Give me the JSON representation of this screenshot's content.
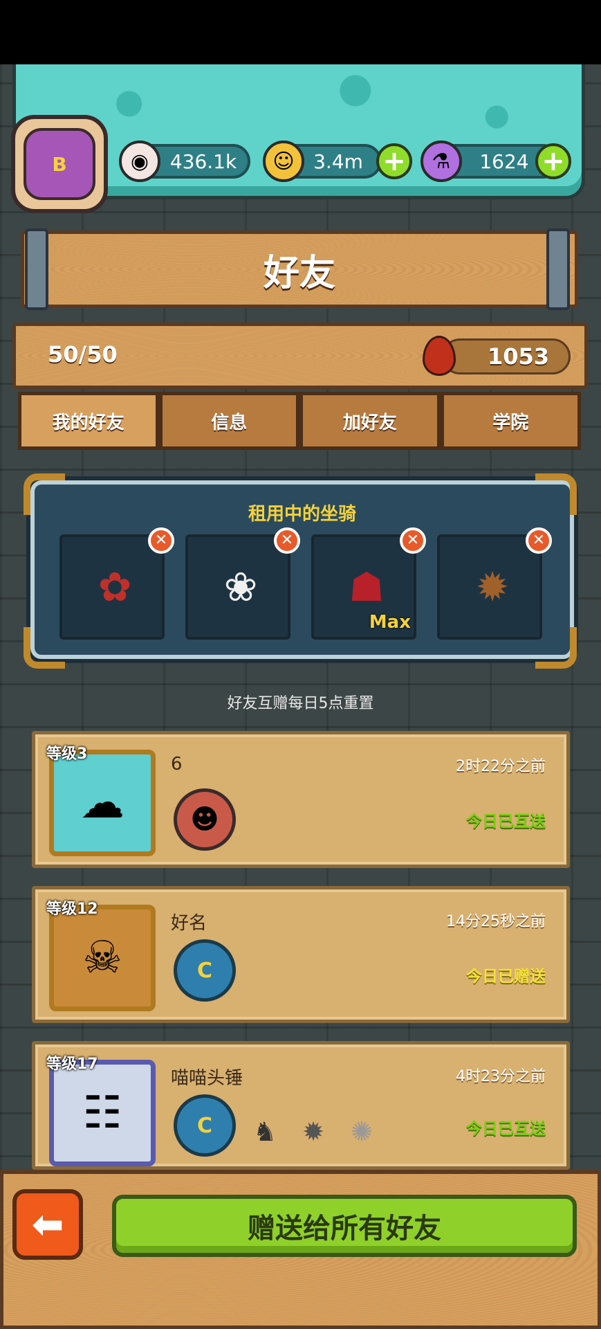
{
  "hud": {
    "avatar_grade": "B",
    "eyeball_value": "436.1k",
    "coin_value": "3.4m",
    "potion_value": "1624"
  },
  "header": {
    "title": "好友"
  },
  "stats": {
    "friend_count": "50/50",
    "blood_value": "1053"
  },
  "tabs": [
    {
      "label": "我的好友",
      "active": true
    },
    {
      "label": "信息",
      "active": false
    },
    {
      "label": "加好友",
      "active": false
    },
    {
      "label": "学院",
      "active": false
    }
  ],
  "rental": {
    "title": "租用中的坐骑",
    "mounts": [
      {
        "icon": "rose-mount-icon",
        "tag": ""
      },
      {
        "icon": "lion-dance-mount-icon",
        "tag": ""
      },
      {
        "icon": "red-demon-mount-icon",
        "tag": "Max"
      },
      {
        "icon": "spiked-boar-mount-icon",
        "tag": ""
      }
    ]
  },
  "notice": "好友互赠每日5点重置",
  "friends": [
    {
      "level": "等级3",
      "name": "6",
      "time": "2时22分之前",
      "status": "今日已互送",
      "badge": ""
    },
    {
      "level": "等级12",
      "name": "好名",
      "time": "14分25秒之前",
      "status": "今日已赠送",
      "badge": "C"
    },
    {
      "level": "等级17",
      "name": "喵喵头锤",
      "time": "4时23分之前",
      "status": "今日已互送",
      "badge": "C"
    }
  ],
  "footer": {
    "send_all_label": "赠送给所有好友"
  },
  "colors": {
    "teal": "#5fd3c9",
    "wood": "#d8a05e",
    "green_button": "#8fd12a",
    "back_button": "#f05a1a"
  }
}
